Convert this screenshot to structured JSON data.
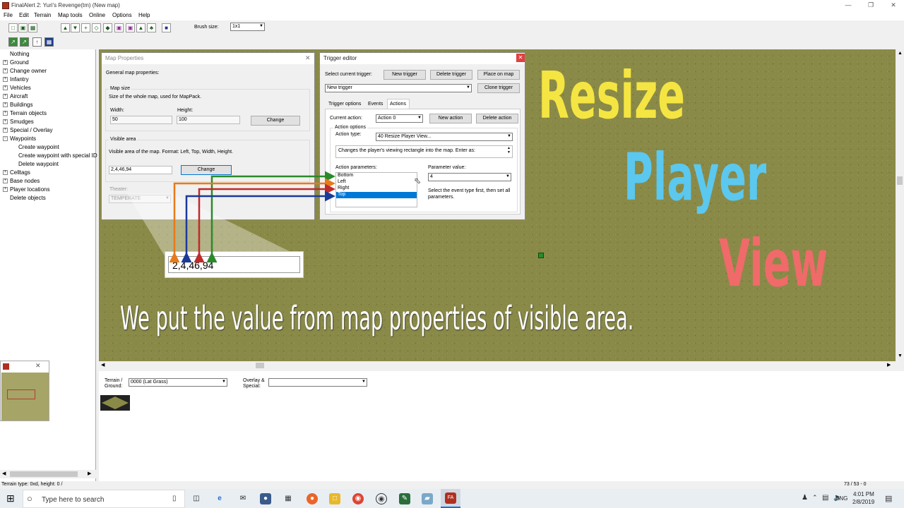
{
  "window": {
    "title": "FinalAlert 2: Yuri's Revenge(tm) (New map)"
  },
  "menu": [
    "File",
    "Edit",
    "Terrain",
    "Map tools",
    "Online",
    "Options",
    "Help"
  ],
  "toolbar": {
    "brush_label": "Brush size:",
    "brush_value": "1x1"
  },
  "tree": [
    {
      "label": "Nothing",
      "expandable": false,
      "indent": 0
    },
    {
      "label": "Ground",
      "expandable": true,
      "indent": 0
    },
    {
      "label": "Change owner",
      "expandable": true,
      "indent": 0
    },
    {
      "label": "Infantry",
      "expandable": true,
      "indent": 0
    },
    {
      "label": "Vehicles",
      "expandable": true,
      "indent": 0
    },
    {
      "label": "Aircraft",
      "expandable": true,
      "indent": 0
    },
    {
      "label": "Buildings",
      "expandable": true,
      "indent": 0
    },
    {
      "label": "Terrain objects",
      "expandable": true,
      "indent": 0
    },
    {
      "label": "Smudges",
      "expandable": true,
      "indent": 0
    },
    {
      "label": "Special / Overlay",
      "expandable": true,
      "indent": 0
    },
    {
      "label": "Waypoints",
      "expandable": true,
      "expanded": true,
      "indent": 0
    },
    {
      "label": "Create waypoint",
      "expandable": false,
      "indent": 1
    },
    {
      "label": "Create waypoint with special ID",
      "expandable": false,
      "indent": 1
    },
    {
      "label": "Delete waypoint",
      "expandable": false,
      "indent": 1
    },
    {
      "label": "Celltags",
      "expandable": true,
      "indent": 0
    },
    {
      "label": "Base nodes",
      "expandable": true,
      "indent": 0
    },
    {
      "label": "Player locations",
      "expandable": true,
      "indent": 0
    },
    {
      "label": "Delete objects",
      "expandable": false,
      "indent": 0
    }
  ],
  "map_properties": {
    "title": "Map Properties",
    "general": "General map properties:",
    "map_size_group": "Map size",
    "map_size_desc": "Size of the whole map, used for MapPack.",
    "width_label": "Width:",
    "width_value": "50",
    "height_label": "Height:",
    "height_value": "100",
    "change_label": "Change",
    "visible_group": "Visible area",
    "visible_desc": "Visible area of the map. Format: Left, Top, Width, Height.",
    "visible_value": "2,4,46,94",
    "visible_change": "Change",
    "theater_label": "Theater:",
    "theater_value": "TEMPERATE"
  },
  "zoom_callout": {
    "value": "2,4,46,94"
  },
  "trigger_editor": {
    "title": "Trigger editor",
    "select_label": "Select current trigger:",
    "new_trigger": "New trigger",
    "delete_trigger": "Delete trigger",
    "place_on_map": "Place on map",
    "clone_trigger": "Clone trigger",
    "current_trigger": "New trigger",
    "tabs": [
      "Trigger options",
      "Events",
      "Actions"
    ],
    "current_action_label": "Current action:",
    "current_action_value": "Action 0",
    "new_action": "New action",
    "delete_action": "Delete action",
    "action_options": "Action options",
    "action_type_label": "Action type:",
    "action_type_value": "40 Resize Player View...",
    "action_desc": "Changes the player's viewing rectangle into the map.  Enter as:",
    "params_label": "Action parameters:",
    "params": [
      "Bottom",
      "Left",
      "Right",
      "Top"
    ],
    "param_value_label": "Parameter value:",
    "param_value": "4",
    "hint": "Select the event type first, then set all parameters."
  },
  "overlay": {
    "word1": "Resize",
    "word2": "Player",
    "word3": "View",
    "caption": "We put the value from map properties of visible area.",
    "colors": {
      "word1": "#f4e542",
      "word2": "#5bc8ef",
      "word3": "#f06a6a"
    }
  },
  "bottom_panel": {
    "terrain_label": "Terrain / Ground:",
    "terrain_value": "0000 (Lat Grass)",
    "overlay_label": "Overlay & Special:",
    "overlay_value": ""
  },
  "status": {
    "left": "Terrain type: 0xd, height: 0 /",
    "right": "73 / 53 - 0"
  },
  "taskbar": {
    "search_placeholder": "Type here to search",
    "lang": "ENG",
    "time": "4:01 PM",
    "date": "2/8/2019"
  }
}
